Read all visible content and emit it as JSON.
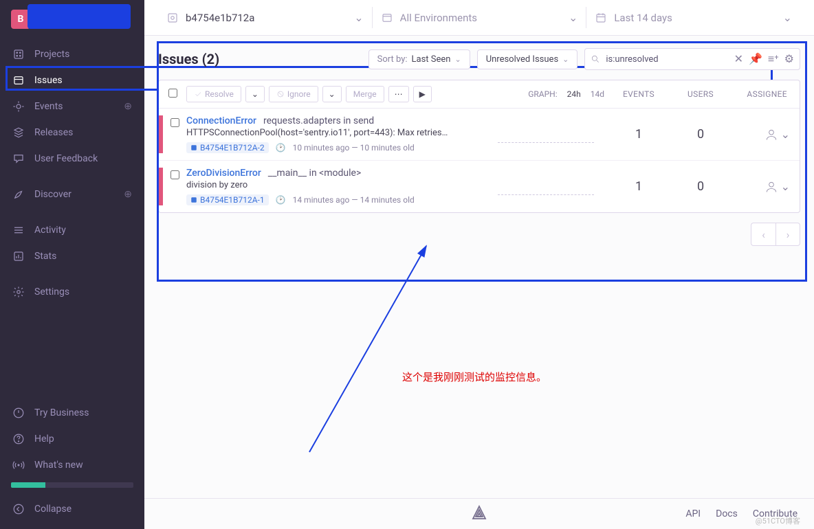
{
  "org": {
    "badge": "B"
  },
  "sidebar": {
    "items": [
      {
        "label": "Projects"
      },
      {
        "label": "Issues"
      },
      {
        "label": "Events"
      },
      {
        "label": "Releases"
      },
      {
        "label": "User Feedback"
      },
      {
        "label": "Discover"
      },
      {
        "label": "Activity"
      },
      {
        "label": "Stats"
      },
      {
        "label": "Settings"
      }
    ],
    "bottom": [
      {
        "label": "Try Business"
      },
      {
        "label": "Help"
      },
      {
        "label": "What's new"
      }
    ],
    "collapse": "Collapse",
    "progress_pct": 28
  },
  "topbar": {
    "project": "b4754e1b712a",
    "env": "All Environments",
    "range": "Last 14 days"
  },
  "page": {
    "title": "Issues (2)",
    "sort_label": "Sort by:",
    "sort_value": "Last Seen",
    "filter_label": "Unresolved Issues",
    "search_value": "is:unresolved"
  },
  "table": {
    "actions": {
      "resolve": "Resolve",
      "ignore": "Ignore",
      "merge": "Merge"
    },
    "headers": {
      "graph": "GRAPH:",
      "t24h": "24h",
      "t14d": "14d",
      "events": "EVENTS",
      "users": "USERS",
      "assignee": "ASSIGNEE"
    },
    "rows": [
      {
        "title": "ConnectionError",
        "source": "requests.adapters in send",
        "desc": "HTTPSConnectionPool(host='sentry.io11', port=443): Max retries…",
        "tag": "B4754E1B712A-2",
        "time": "10 minutes ago — 10 minutes old",
        "events": "1",
        "users": "0"
      },
      {
        "title": "ZeroDivisionError",
        "source": "__main__ in <module>",
        "desc": "division by zero",
        "tag": "B4754E1B712A-1",
        "time": "14 minutes ago — 14 minutes old",
        "events": "1",
        "users": "0"
      }
    ]
  },
  "annotation": "这个是我刚刚测试的监控信息。",
  "footer": {
    "api": "API",
    "docs": "Docs",
    "contribute": "Contribute"
  },
  "watermark": "@51CTO博客"
}
